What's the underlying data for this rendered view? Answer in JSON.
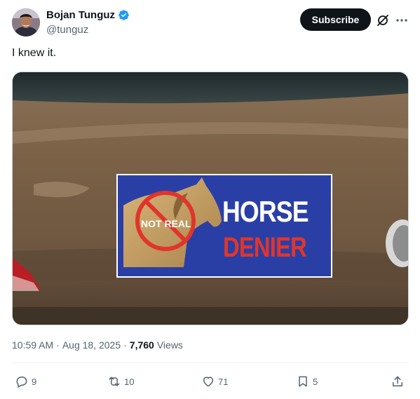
{
  "author": {
    "name": "Bojan Tunguz",
    "handle": "@tunguz",
    "avatar_icon": "profile-photo"
  },
  "header": {
    "subscribe_label": "Subscribe",
    "grok_icon": "slash-circle-icon",
    "more_icon": "more-horizontal-icon"
  },
  "tweet": {
    "text": "I knew it."
  },
  "media": {
    "sticker_top_text": "HORSE",
    "sticker_bottom_text": "DENIER",
    "sticker_badge_text": "NOT REAL"
  },
  "meta": {
    "time": "10:59 AM",
    "sep1": "·",
    "date": "Aug 18, 2025",
    "sep2": "·",
    "views_count": "7,760",
    "views_label": "Views"
  },
  "actions": {
    "replies": "9",
    "reposts": "10",
    "likes": "71",
    "bookmarks": "5"
  },
  "colors": {
    "accent": "#1d9bf0",
    "text_secondary": "#536471",
    "sticker_blue": "#2a3fa6",
    "sticker_red": "#e0352b"
  }
}
